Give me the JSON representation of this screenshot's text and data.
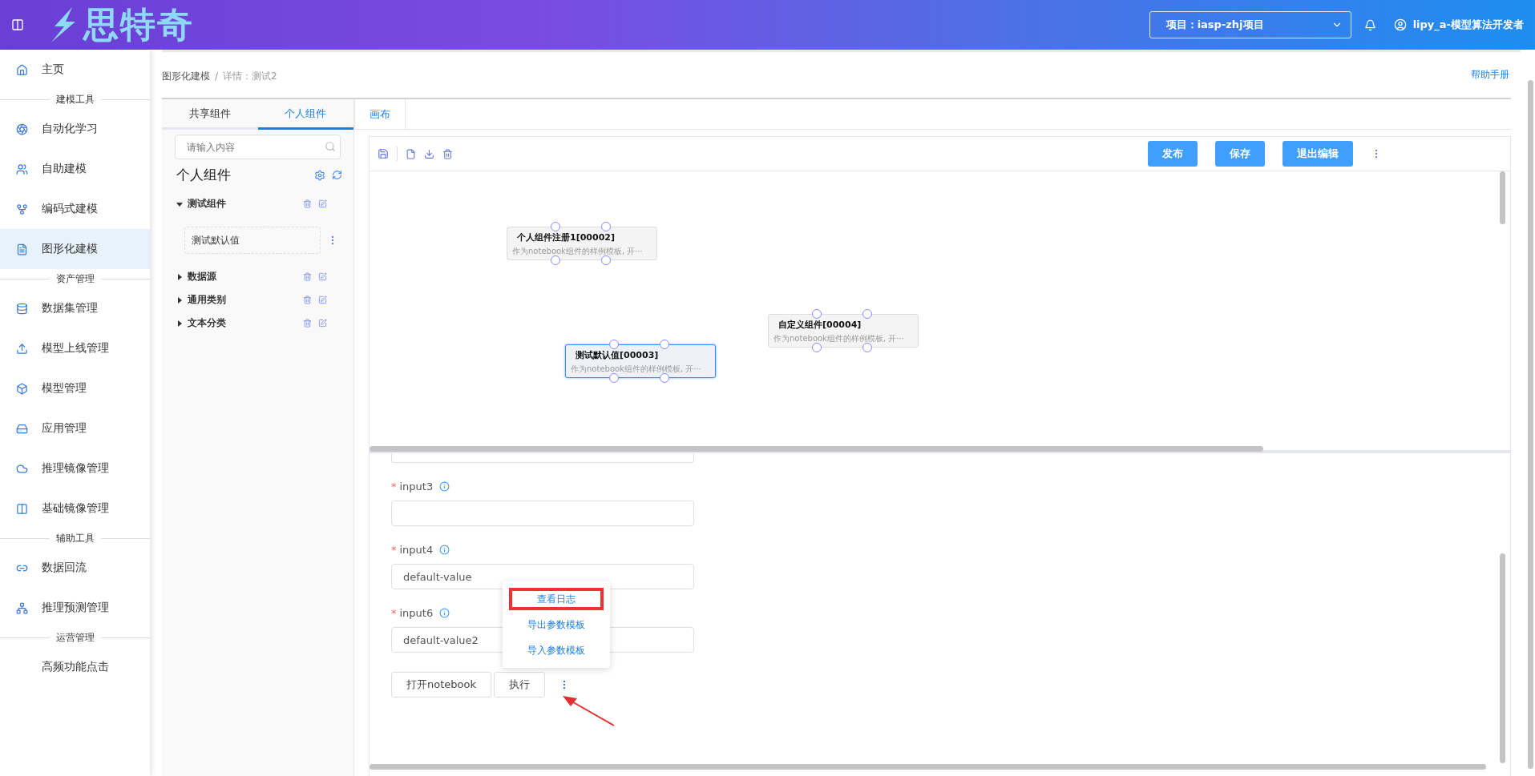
{
  "header": {
    "logo_text": "思特奇",
    "project": "项目：iasp-zhj项目",
    "user": "lipy_a-模型算法开发者"
  },
  "sidebar": [
    {
      "kind": "item",
      "label": "主页",
      "selected": false
    },
    {
      "kind": "section",
      "label": "建模工具"
    },
    {
      "kind": "item",
      "label": "自动化学习",
      "selected": false
    },
    {
      "kind": "item",
      "label": "自助建模",
      "selected": false
    },
    {
      "kind": "item",
      "label": "编码式建模",
      "selected": false
    },
    {
      "kind": "item",
      "label": "图形化建模",
      "selected": true
    },
    {
      "kind": "section",
      "label": "资产管理"
    },
    {
      "kind": "item",
      "label": "数据集管理",
      "selected": false
    },
    {
      "kind": "item",
      "label": "模型上线管理",
      "selected": false
    },
    {
      "kind": "item",
      "label": "模型管理",
      "selected": false
    },
    {
      "kind": "item",
      "label": "应用管理",
      "selected": false
    },
    {
      "kind": "item",
      "label": "推理镜像管理",
      "selected": false
    },
    {
      "kind": "item",
      "label": "基础镜像管理",
      "selected": false
    },
    {
      "kind": "section",
      "label": "辅助工具"
    },
    {
      "kind": "item",
      "label": "数据回流",
      "selected": false
    },
    {
      "kind": "item",
      "label": "推理预测管理",
      "selected": false
    },
    {
      "kind": "section",
      "label": "运营管理"
    },
    {
      "kind": "item",
      "label": "高频功能点击",
      "selected": false
    }
  ],
  "breadcrumb": [
    "图形化建模",
    "详情：测试2"
  ],
  "breadcrumb_separator": "/",
  "help_link": "帮助手册",
  "component_panel": {
    "tabs": [
      {
        "label": "共享组件",
        "selected": false
      },
      {
        "label": "个人组件",
        "selected": true
      }
    ],
    "search": {
      "placeholder": "请输入内容"
    },
    "title": "个人组件",
    "groups": [
      {
        "label": "测试组件",
        "expanded": true,
        "children": [
          {
            "label": "测试默认值"
          }
        ]
      },
      {
        "label": "数据源",
        "expanded": false
      },
      {
        "label": "通用类别",
        "expanded": false
      },
      {
        "label": "文本分类",
        "expanded": false
      }
    ]
  },
  "canvas_tab": {
    "label": "画布",
    "selected": true
  },
  "toolbar": {
    "buttons": [
      "发布",
      "保存",
      "退出编辑"
    ]
  },
  "nodes": [
    {
      "title": "个人组件注册1[00002]",
      "description": "作为notebook组件的样例模板, 开⋯",
      "selected": false
    },
    {
      "title": "自定义组件[00004]",
      "description": "作为notebook组件的样例模板, 开⋯",
      "selected": false
    },
    {
      "title": "测试默认值[00003]",
      "description": "作为notebook组件的样例模板, 开⋯",
      "selected": true
    }
  ],
  "form": {
    "required_mark": "*",
    "fields": [
      {
        "label": "input3",
        "required": true
      },
      {
        "label": "input4",
        "required": true,
        "value": "default-value"
      },
      {
        "label": "input6",
        "required": true,
        "value": "default-value2"
      }
    ],
    "actions": [
      "打开notebook",
      "执行"
    ]
  },
  "popup_menu": [
    {
      "label": "查看日志",
      "annotated": true
    },
    {
      "label": "导出参数模板",
      "annotated": false
    },
    {
      "label": "导入参数模板",
      "annotated": false
    }
  ]
}
